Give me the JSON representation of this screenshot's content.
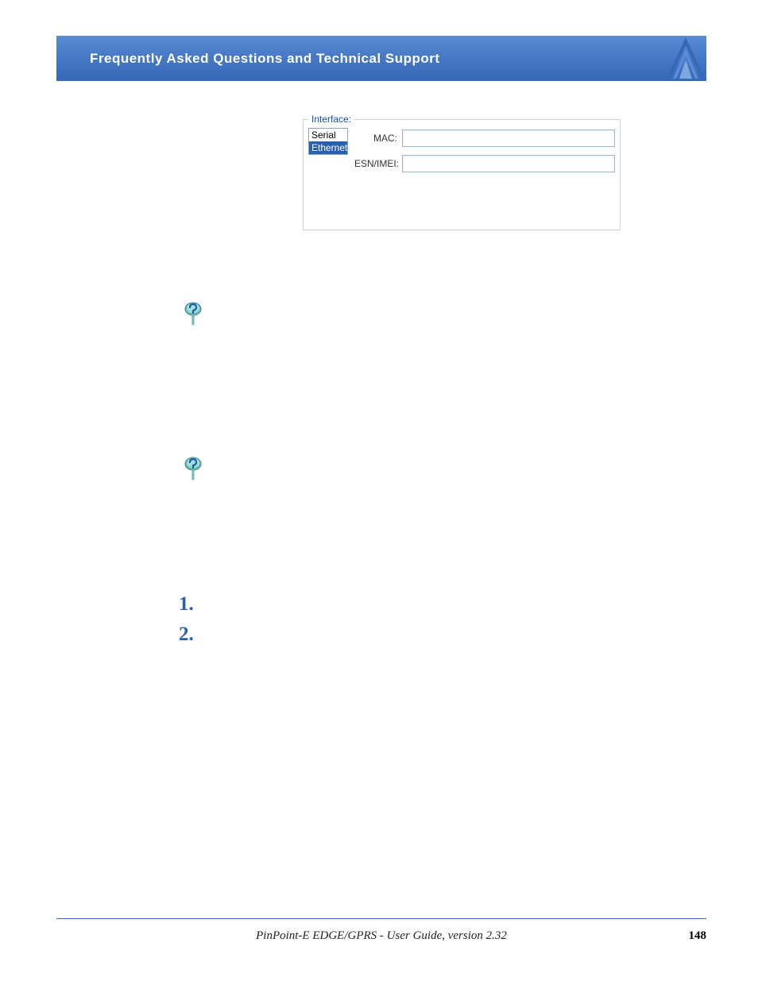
{
  "banner": {
    "title": "Frequently Asked Questions and Technical Support"
  },
  "interface_box": {
    "legend": "Interface:",
    "list": {
      "item0": "Serial",
      "item1": "Ethernet"
    },
    "mac_label": "MAC:",
    "mac_value": "",
    "esn_label": "ESN/IMEI:",
    "esn_value": ""
  },
  "numbered": {
    "one": "1.",
    "two": "2."
  },
  "footer": {
    "doc": "PinPoint-E EDGE/GPRS - User Guide, version 2.32",
    "page": "148"
  }
}
